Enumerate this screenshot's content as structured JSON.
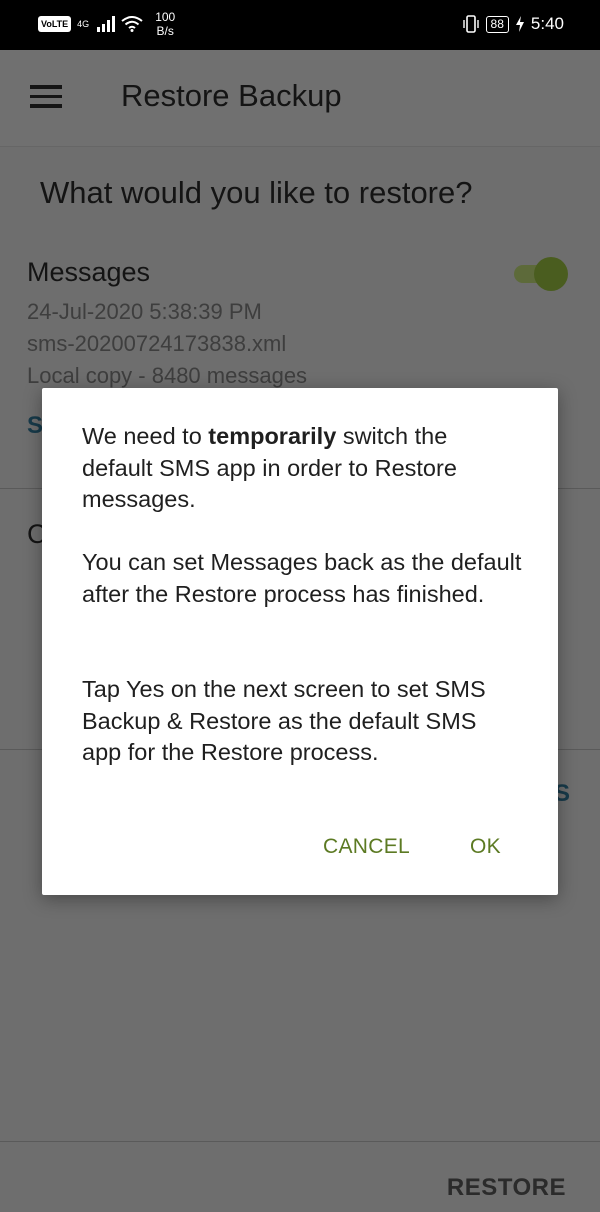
{
  "status_bar": {
    "volte": "VoLTE",
    "network": "4G",
    "speed_value": "100",
    "speed_unit": "B/s",
    "battery": "88",
    "time": "5:40"
  },
  "app_bar": {
    "title": "Restore Backup"
  },
  "main": {
    "question": "What would you like to restore?",
    "messages": {
      "title": "Messages",
      "date": "24-Jul-2020 5:38:39 PM",
      "filename": "sms-20200724173838.xml",
      "count": "Local copy - 8480 messages",
      "toggle_on": true
    },
    "partial_left_s": "S",
    "partial_left_c": "C",
    "partial_right_s": "S"
  },
  "dialog": {
    "p1_before": "We need to ",
    "p1_bold": "temporarily",
    "p1_after": " switch the default SMS app in order to Restore messages.",
    "p2": "You can set Messages back as the default after the Restore process has finished.",
    "p3": "Tap Yes on the next screen to set SMS Backup & Restore as the default SMS app for the Restore process.",
    "cancel_label": "CANCEL",
    "ok_label": "OK"
  },
  "bottom": {
    "restore_label": "RESTORE"
  },
  "colors": {
    "accent": "#5c7a23",
    "scrim_bg": "#6e6e6e"
  }
}
